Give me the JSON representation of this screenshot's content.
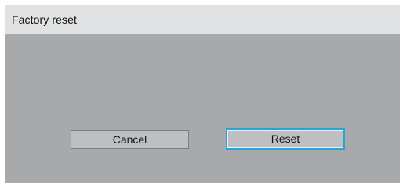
{
  "dialog": {
    "title": "Factory reset",
    "buttons": {
      "cancel_label": "Cancel",
      "reset_label": "Reset"
    },
    "focused_button": "reset"
  },
  "colors": {
    "panel_background": "#a7a9ab",
    "titlebar_background": "#e1e2e3",
    "button_background": "#bdbfc1",
    "focus_outline": "#29a3d6"
  }
}
